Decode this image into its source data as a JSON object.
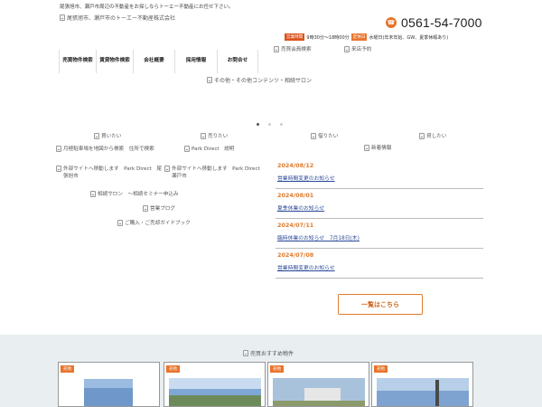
{
  "header": {
    "tagline": "尾張旭市、瀬戸市周辺の不動産をお探しならトーエー不動産にお任せ下さい。",
    "logo_alt": "尾張旭市、瀬戸市のトーエー不動産株式会社",
    "phone": "0561-54-7000",
    "hours_label": "営業時間",
    "hours_value": "9時30分～18時00分",
    "holiday_label": "定休日",
    "holiday_value": "水曜日(年末年始、GW、夏季休暇あり)"
  },
  "nav": {
    "items": [
      {
        "label": "売買物件検索"
      },
      {
        "label": "賃貸物件検索"
      },
      {
        "label": "会社概要"
      },
      {
        "label": "採用情報"
      },
      {
        "label": "お問合せ"
      }
    ],
    "member_label": "売買会員検索",
    "visit_label": "来店予約"
  },
  "hero": {
    "caption": "その他・その他コンテンツ・相続サロン",
    "slides": 3,
    "active_slide": 1
  },
  "links": {
    "buy": "買いたい",
    "sell": "売りたい",
    "borrow": "借りたい",
    "lend": "貸したい",
    "parking": "月極駐車場を地図から検索　住所で検索",
    "park_direct": "Park Direct　説明",
    "news_header": "新着情報",
    "external1": "外部サイトへ移動します　Park Direct　尾張旭市",
    "external2": "外部サイトへ移動します　Park Direct　瀬戸市",
    "salon": "相続サロン　～相続セミナー申込み",
    "blog": "営業ブログ",
    "guide": "ご購入・ご売却ガイドブック"
  },
  "news": {
    "items": [
      {
        "date": "2024/08/12",
        "title": "営業時間変更のお知らせ"
      },
      {
        "date": "2024/08/01",
        "title": "夏季休業のお知らせ"
      },
      {
        "date": "2024/07/11",
        "title": "臨時休業のお知らせ　7月18日(木)"
      },
      {
        "date": "2024/07/08",
        "title": "営業時間変更のお知らせ"
      }
    ],
    "more_label": "一覧はこちら"
  },
  "recommend": {
    "title": "売買おすすめ物件",
    "cards": [
      {
        "badge": "売地"
      },
      {
        "badge": "売地"
      },
      {
        "badge": "売地"
      },
      {
        "badge": "売地"
      }
    ]
  },
  "colors": {
    "accent": "#e8742c",
    "accent_dark": "#d9531e",
    "link": "#2c4a9a",
    "band": "#e9eef1"
  }
}
